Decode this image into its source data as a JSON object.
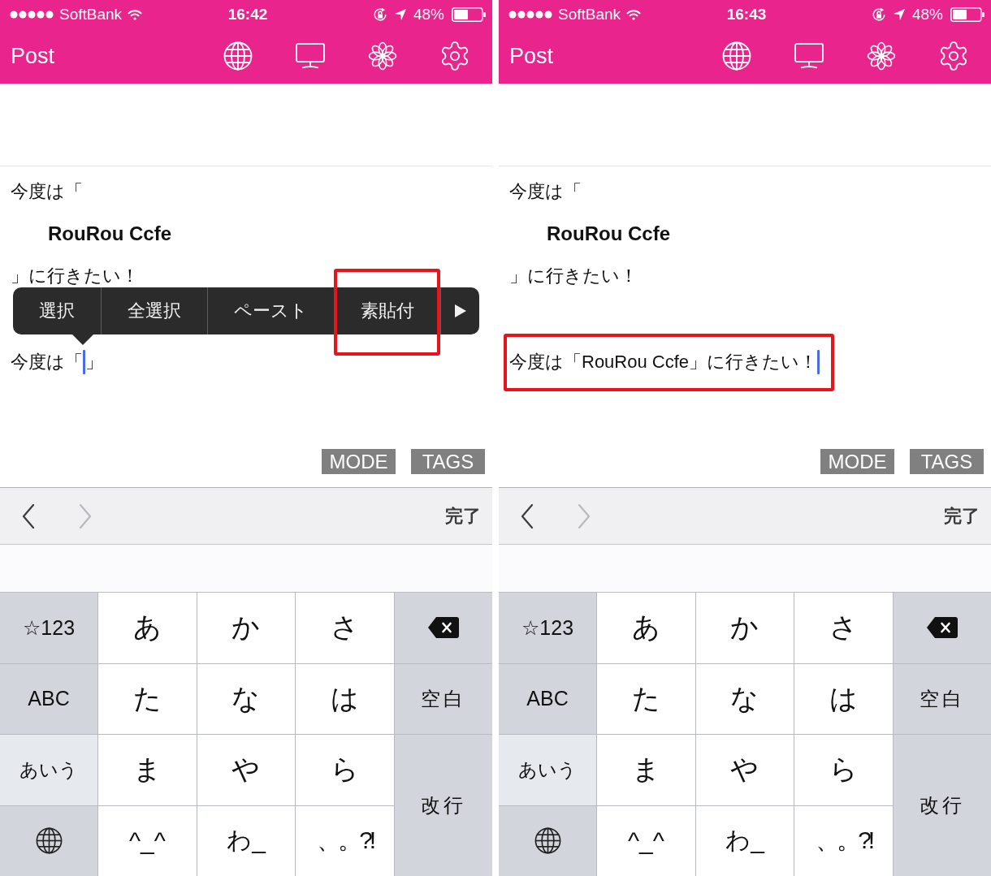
{
  "screens": [
    {
      "status_bar": {
        "carrier": "SoftBank",
        "time": "16:42",
        "battery": "48%"
      },
      "nav_bar": {
        "title": "Post"
      },
      "editor": {
        "lines": [
          {
            "kind": "plain",
            "text": "今度は「"
          },
          {
            "kind": "bold",
            "text": "RouRou Ccfe"
          },
          {
            "kind": "plain",
            "text": "」に行きたい！"
          }
        ],
        "input_line": {
          "before_caret": "今度は「",
          "after_caret": "」",
          "highlighted": false
        }
      },
      "callout_menu": {
        "items": [
          {
            "label": "選択",
            "highlighted": false
          },
          {
            "label": "全選択",
            "highlighted": false
          },
          {
            "label": "ペースト",
            "highlighted": false
          },
          {
            "label": "素貼付",
            "highlighted": true
          }
        ]
      },
      "buttons": [
        "MODE",
        "TAGS"
      ],
      "toolbar": {
        "nav": [
          {
            "kind": "previous",
            "disabled": false
          },
          {
            "kind": "next",
            "disabled": true
          }
        ],
        "done": "完了"
      },
      "keyboard": {
        "mode_keys": [
          {
            "kind": "text",
            "label": "☆123",
            "selected": false
          },
          {
            "kind": "text",
            "label": "ABC",
            "selected": false
          },
          {
            "kind": "text",
            "label": "あいう",
            "selected": true
          },
          {
            "kind": "globe",
            "selected": false
          }
        ],
        "kana_keys": [
          "あ",
          "か",
          "さ",
          "た",
          "な",
          "は",
          "ま",
          "や",
          "ら",
          "^_^",
          "わ_",
          "、。?!"
        ],
        "action_keys": [
          {
            "kind": "delete"
          },
          {
            "kind": "text",
            "label": "空白"
          },
          {
            "kind": "text",
            "label": "改行"
          }
        ]
      }
    },
    {
      "status_bar": {
        "carrier": "SoftBank",
        "time": "16:43",
        "battery": "48%"
      },
      "nav_bar": {
        "title": "Post"
      },
      "editor": {
        "lines": [
          {
            "kind": "plain",
            "text": "今度は「"
          },
          {
            "kind": "bold",
            "text": "RouRou Ccfe"
          },
          {
            "kind": "plain",
            "text": "」に行きたい！"
          }
        ],
        "input_line": {
          "before_caret": "今度は「RouRou Ccfe」に行きたい！",
          "highlighted": true
        }
      },
      "buttons": [
        "MODE",
        "TAGS"
      ],
      "toolbar": {
        "nav": [
          {
            "kind": "previous",
            "disabled": false
          },
          {
            "kind": "next",
            "disabled": true
          }
        ],
        "done": "完了"
      },
      "keyboard": {
        "mode_keys": [
          {
            "kind": "text",
            "label": "☆123",
            "selected": false
          },
          {
            "kind": "text",
            "label": "ABC",
            "selected": false
          },
          {
            "kind": "text",
            "label": "あいう",
            "selected": true
          },
          {
            "kind": "globe",
            "selected": false
          }
        ],
        "kana_keys": [
          "あ",
          "か",
          "さ",
          "た",
          "な",
          "は",
          "ま",
          "や",
          "ら",
          "^_^",
          "わ_",
          "、。?!"
        ],
        "action_keys": [
          {
            "kind": "delete"
          },
          {
            "kind": "text",
            "label": "空白"
          },
          {
            "kind": "text",
            "label": "改行"
          }
        ]
      }
    }
  ]
}
